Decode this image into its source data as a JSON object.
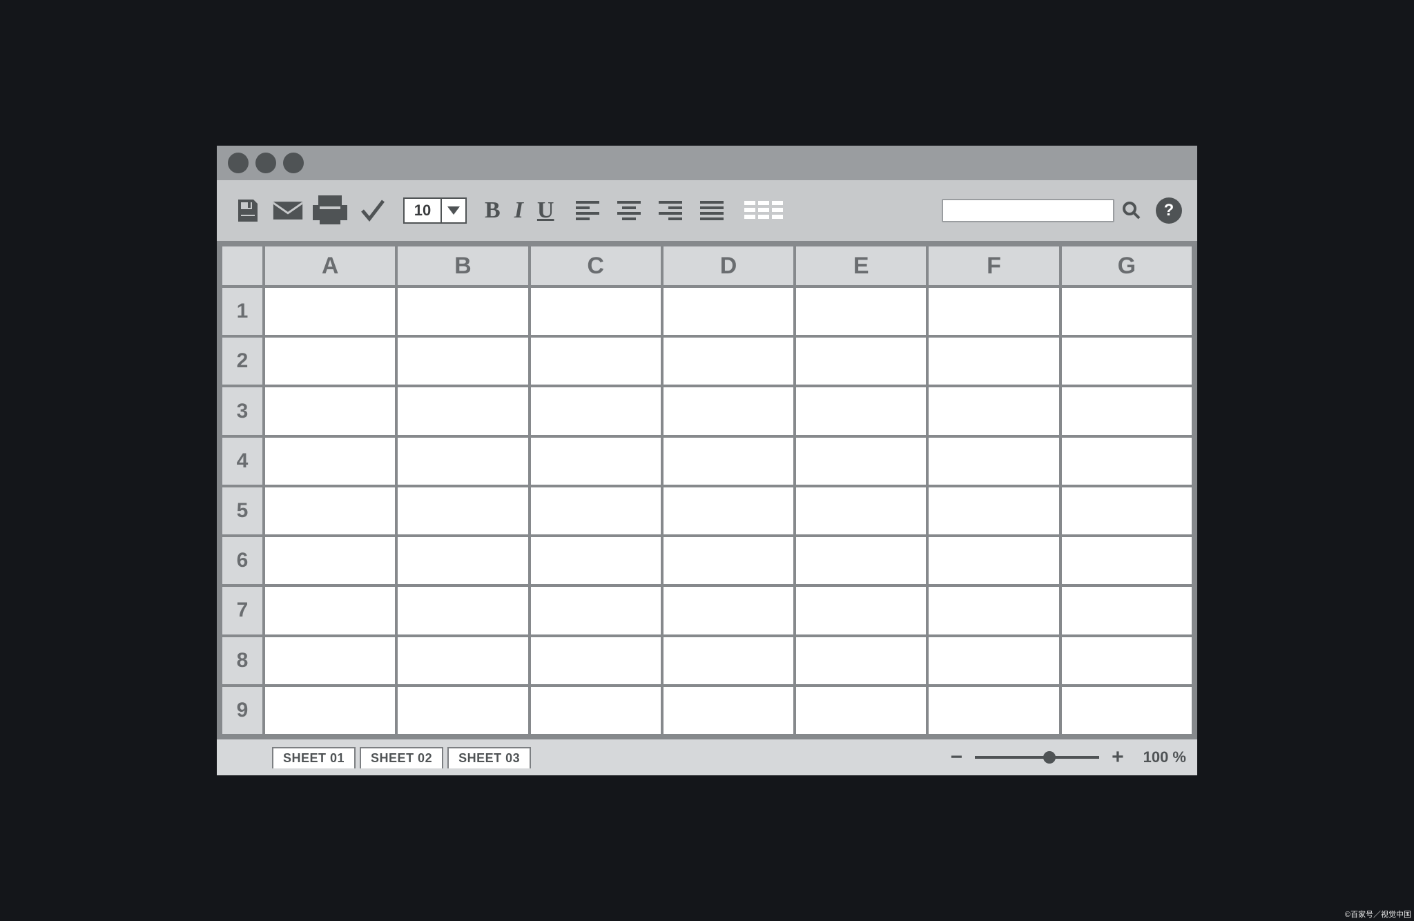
{
  "toolbar": {
    "font_size": "10",
    "bold_label": "B",
    "italic_label": "I",
    "underline_label": "U",
    "help_label": "?",
    "search_value": ""
  },
  "sheet": {
    "columns": [
      "A",
      "B",
      "C",
      "D",
      "E",
      "F",
      "G"
    ],
    "rows": [
      "1",
      "2",
      "3",
      "4",
      "5",
      "6",
      "7",
      "8",
      "9"
    ],
    "cells": {}
  },
  "tabs": [
    "SHEET 01",
    "SHEET 02",
    "SHEET 03"
  ],
  "status": {
    "zoom_label": "100 %",
    "zoom_minus": "−",
    "zoom_plus": "+"
  },
  "watermark": "©百家号／视觉中国"
}
